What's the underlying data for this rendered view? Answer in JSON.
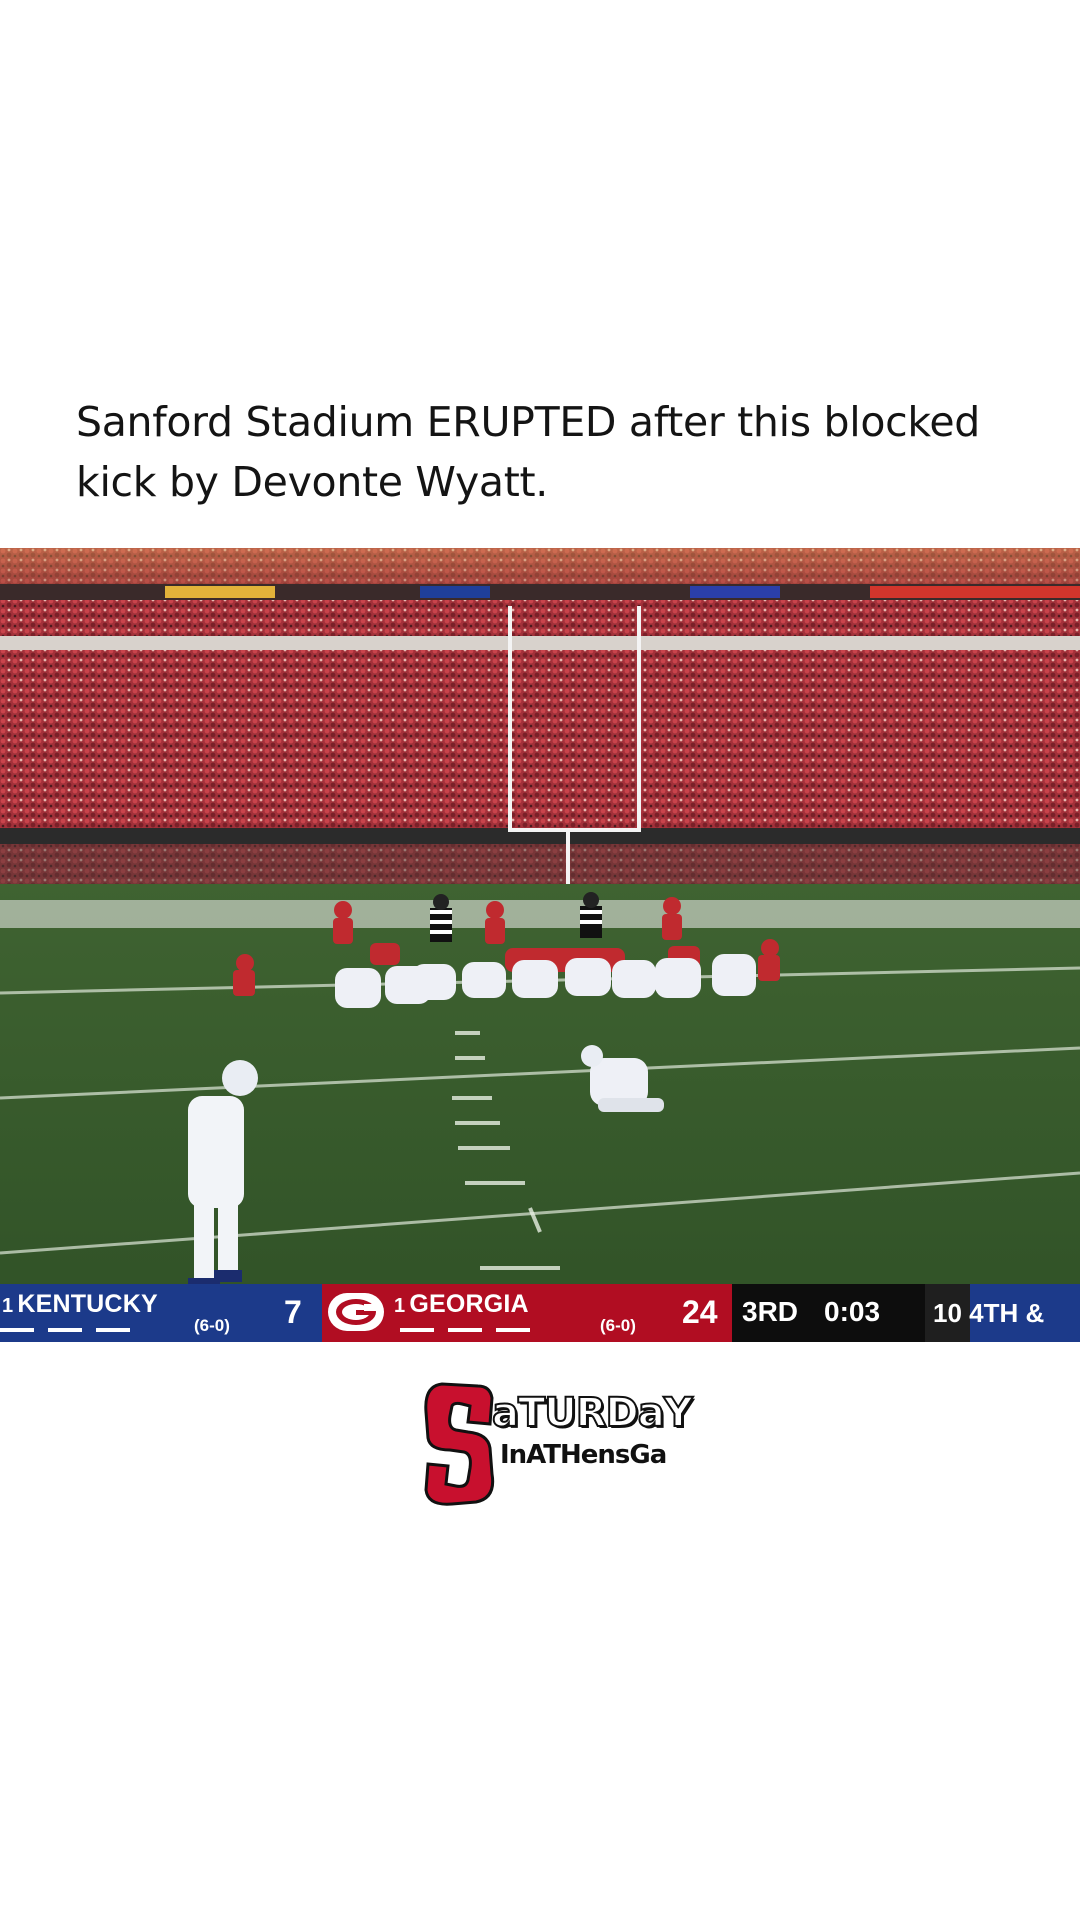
{
  "post": {
    "caption": "Sanford Stadium ERUPTED after this blocked kick by Devonte Wyatt."
  },
  "scorebug": {
    "away": {
      "rank": "1",
      "name": "KENTUCKY",
      "record": "(6-0)",
      "score": "7",
      "color": "#1c3a8a"
    },
    "home": {
      "rank": "1",
      "name": "GEORGIA",
      "record": "(6-0)",
      "score": "24",
      "color": "#b10d22",
      "logo_icon": "georgia-g-logo"
    },
    "quarter": "3RD",
    "clock": "0:03",
    "down": "10 4TH &"
  },
  "watermark": {
    "letter": "S",
    "line1": "aTURDaY",
    "line2": "InATHensGa",
    "color": "#c8102e"
  }
}
